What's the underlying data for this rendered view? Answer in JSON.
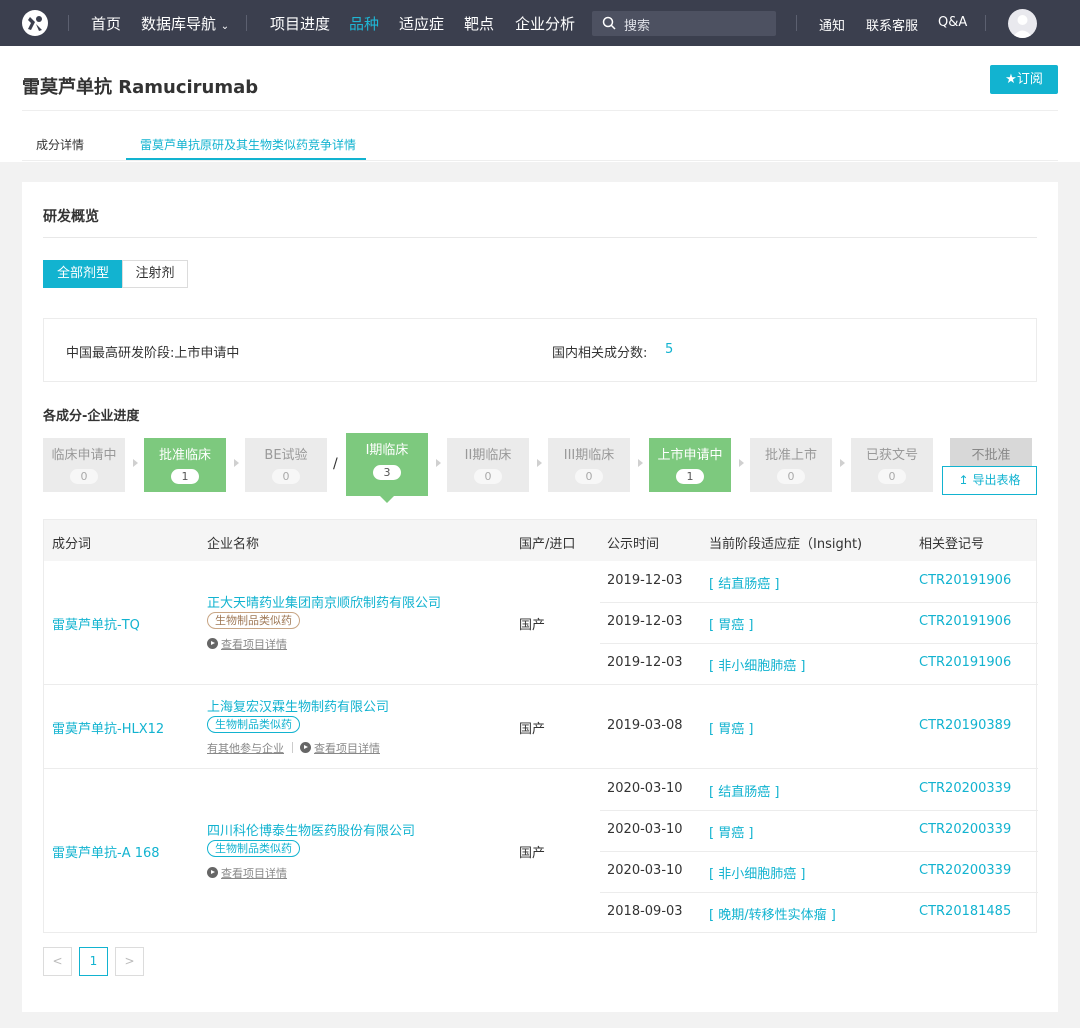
{
  "nav": {
    "items": [
      "首页",
      "数据库导航",
      "项目进度",
      "品种",
      "适应症",
      "靶点",
      "企业分析"
    ],
    "active": "品种",
    "search_placeholder": "搜索",
    "right": [
      "通知",
      "联系客服",
      "Q&A"
    ]
  },
  "header": {
    "title": "雷莫芦单抗 Ramucirumab",
    "subscribe": "★订阅",
    "tabs": [
      "成分详情",
      "雷莫芦单抗原研及其生物类似药竞争详情"
    ]
  },
  "overview": {
    "title": "研发概览",
    "filters": [
      "全部剂型",
      "注射剂"
    ],
    "highest_stage_label": "中国最高研发阶段:",
    "highest_stage_value": "上市申请中",
    "count_label": "国内相关成分数:",
    "count_value": "5"
  },
  "progress": {
    "title": "各成分-企业进度",
    "stages": [
      {
        "name": "临床申请中",
        "count": "0"
      },
      {
        "name": "批准临床",
        "count": "1"
      },
      {
        "name": "BE试验",
        "count": "0"
      },
      {
        "name": "I期临床",
        "count": "3"
      },
      {
        "name": "II期临床",
        "count": "0"
      },
      {
        "name": "III期临床",
        "count": "0"
      },
      {
        "name": "上市申请中",
        "count": "1"
      },
      {
        "name": "批准上市",
        "count": "0"
      },
      {
        "name": "已获文号",
        "count": "0"
      },
      {
        "name": "不批准",
        "count": ""
      }
    ],
    "separator": "/",
    "export": "导出表格"
  },
  "table": {
    "headers": [
      "成分词",
      "企业名称",
      "国产/进口",
      "公示时间",
      "当前阶段适应症（Insight)",
      "相关登记号"
    ],
    "groups": [
      {
        "ingredient": "雷莫芦单抗-TQ",
        "company": "正大天晴药业集团南京顺欣制药有限公司",
        "tag": "生物制品类似药",
        "detail": "查看项目详情",
        "other": "",
        "origin": "国产",
        "rows": [
          {
            "date": "2019-12-03",
            "indication": "[ 结直肠癌 ]",
            "reg": "CTR20191906"
          },
          {
            "date": "2019-12-03",
            "indication": "[ 胃癌 ]",
            "reg": "CTR20191906"
          },
          {
            "date": "2019-12-03",
            "indication": "[ 非小细胞肺癌 ]",
            "reg": "CTR20191906"
          }
        ]
      },
      {
        "ingredient": "雷莫芦单抗-HLX12",
        "company": "上海复宏汉霖生物制药有限公司",
        "tag": "生物制品类似药",
        "detail": "查看项目详情",
        "other": "有其他参与企业",
        "origin": "国产",
        "rows": [
          {
            "date": "2019-03-08",
            "indication": "[ 胃癌 ]",
            "reg": "CTR20190389"
          }
        ]
      },
      {
        "ingredient": "雷莫芦单抗-A 168",
        "company": "四川科伦博泰生物医药股份有限公司",
        "tag": "生物制品类似药",
        "detail": "查看项目详情",
        "other": "",
        "origin": "国产",
        "rows": [
          {
            "date": "2020-03-10",
            "indication": "[ 结直肠癌 ]",
            "reg": "CTR20200339"
          },
          {
            "date": "2020-03-10",
            "indication": "[ 胃癌 ]",
            "reg": "CTR20200339"
          },
          {
            "date": "2020-03-10",
            "indication": "[ 非小细胞肺癌 ]",
            "reg": "CTR20200339"
          },
          {
            "date": "2018-09-03",
            "indication": "[ 晚期/转移性实体瘤 ]",
            "reg": "CTR20181485"
          }
        ]
      }
    ]
  },
  "pagination": {
    "prev": "<",
    "current": "1",
    "next": ">"
  },
  "colors": {
    "accent": "#12b3d0",
    "nav_bg": "#3b3f4e",
    "stage_active": "#7dc97e"
  }
}
